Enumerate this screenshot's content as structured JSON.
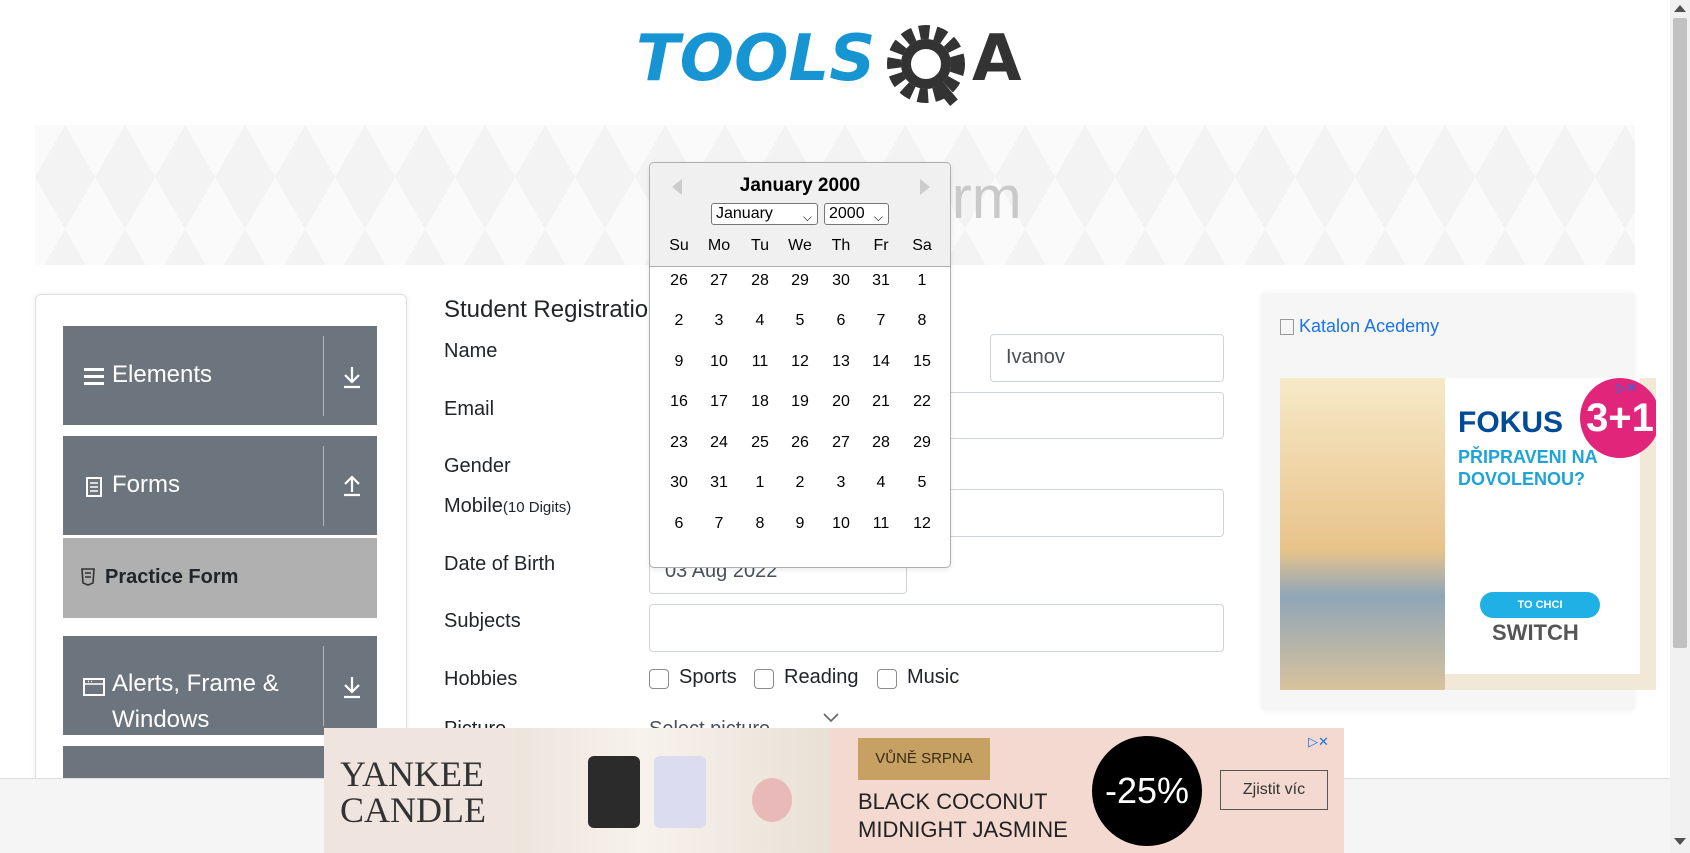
{
  "logo": {
    "text": "TOOLSQA"
  },
  "banner": {
    "title": "Practice Form"
  },
  "sidebar": {
    "groups": [
      {
        "label": "Elements",
        "icon": "menu-icon",
        "arrow": "download-arrow-icon"
      },
      {
        "label": "Forms",
        "icon": "document-icon",
        "arrow": "upload-arrow-icon"
      },
      {
        "label": "Alerts, Frame & Windows",
        "icon": "window-icon",
        "arrow": "download-arrow-icon"
      }
    ],
    "active_item": {
      "label": "Practice Form",
      "icon": "html-icon"
    }
  },
  "form": {
    "title": "Student Registration Form",
    "labels": {
      "name": "Name",
      "email": "Email",
      "gender": "Gender",
      "mobile": "Mobile",
      "mobile_hint": "(10 Digits)",
      "dob": "Date of Birth",
      "subjects": "Subjects",
      "hobbies": "Hobbies",
      "picture": "Picture"
    },
    "last_name_value": "Ivanov",
    "dob_value": "03 Aug 2022",
    "picture_placeholder": "Select picture",
    "hobbies": [
      "Sports",
      "Reading",
      "Music"
    ]
  },
  "datepicker": {
    "header": "January 2000",
    "month_select": "January",
    "year_select": "2000",
    "day_names": [
      "Su",
      "Mo",
      "Tu",
      "We",
      "Th",
      "Fr",
      "Sa"
    ],
    "weeks": [
      [
        "26",
        "27",
        "28",
        "29",
        "30",
        "31",
        "1"
      ],
      [
        "2",
        "3",
        "4",
        "5",
        "6",
        "7",
        "8"
      ],
      [
        "9",
        "10",
        "11",
        "12",
        "13",
        "14",
        "15"
      ],
      [
        "16",
        "17",
        "18",
        "19",
        "20",
        "21",
        "22"
      ],
      [
        "23",
        "24",
        "25",
        "26",
        "27",
        "28",
        "29"
      ],
      [
        "30",
        "31",
        "1",
        "2",
        "3",
        "4",
        "5"
      ],
      [
        "6",
        "7",
        "8",
        "9",
        "10",
        "11",
        "12"
      ]
    ]
  },
  "right_ad": {
    "image_alt": "Katalon Acedemy",
    "brand": "FOKUS",
    "tagline": "PŘIPRAVENI NA DOVOLENOU?",
    "badge": "3+1",
    "badge_prefix": "AK",
    "button": "TO CHCI",
    "product": "SWITCH"
  },
  "bottom_ad": {
    "brand_line1": "YANKEE",
    "brand_line2": "CANDLE",
    "tag": "VŮNĚ SRPNA",
    "product_line1": "BLACK COCONUT",
    "product_line2": "MIDNIGHT JASMINE",
    "discount": "-25%",
    "cta": "Zjistit víc"
  },
  "colors": {
    "logo_blue": "#1795d3",
    "logo_dark": "#333333",
    "sidebar_group": "#6c757d",
    "sidebar_active": "#b0b0b0"
  }
}
